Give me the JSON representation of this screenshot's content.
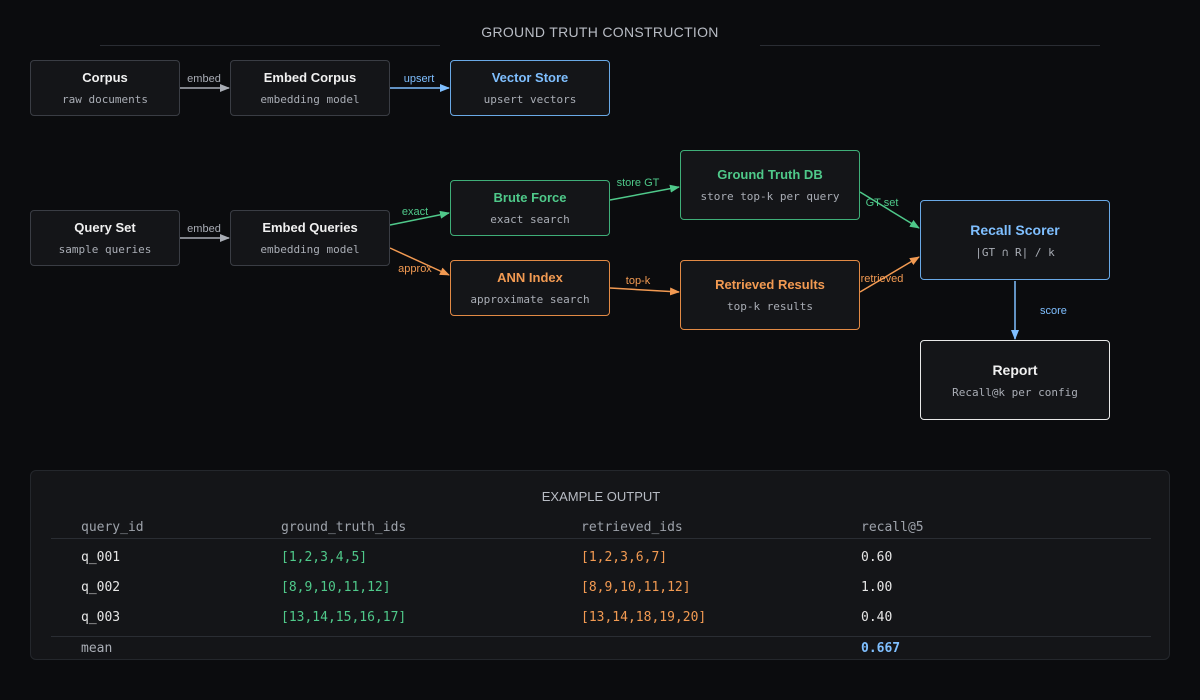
{
  "diagram": {
    "title": "GROUND TRUTH CONSTRUCTION",
    "nodes": {
      "corpus": {
        "title": "Corpus",
        "sub": "raw documents"
      },
      "embed_corpus": {
        "title": "Embed Corpus",
        "sub": "embedding model"
      },
      "vector_store": {
        "title": "Vector Store",
        "sub": "upsert vectors"
      },
      "query_set": {
        "title": "Query Set",
        "sub": "sample queries"
      },
      "embed_queries": {
        "title": "Embed Queries",
        "sub": "embedding model"
      },
      "brute_force": {
        "title": "Brute Force",
        "sub": "exact search"
      },
      "ann_index": {
        "title": "ANN Index",
        "sub": "approximate search"
      },
      "ground_truth_db": {
        "title": "Ground Truth DB",
        "sub": "store top-k per query"
      },
      "retrieved_results": {
        "title": "Retrieved Results",
        "sub": "top-k results"
      },
      "recall_scorer": {
        "title": "Recall Scorer",
        "sub": "|GT ∩ R| / k"
      },
      "report": {
        "title": "Report",
        "sub": "Recall@k per config"
      }
    },
    "edges": {
      "embed_1": "embed",
      "upsert": "upsert",
      "embed_2": "embed",
      "exact": "exact",
      "approx": "approx",
      "store_gt": "store GT",
      "top_k": "top-k",
      "gt_set": "GT set",
      "retrieved": "retrieved",
      "score": "score"
    },
    "colors": {
      "blue": "#7fbfff",
      "green": "#4fc98a",
      "orange": "#f29a52",
      "gray": "#a9adb5"
    }
  },
  "example": {
    "title": "EXAMPLE OUTPUT",
    "headers": [
      "query_id",
      "ground_truth_ids",
      "retrieved_ids",
      "recall@5"
    ],
    "rows": [
      [
        "q_001",
        "[1,2,3,4,5]",
        "[1,2,3,6,7]",
        "0.60"
      ],
      [
        "q_002",
        "[8,9,10,11,12]",
        "[8,9,10,11,12]",
        "1.00"
      ],
      [
        "q_003",
        "[13,14,15,16,17]",
        "[13,14,18,19,20]",
        "0.40"
      ]
    ],
    "mean_label": "mean",
    "mean_value": "0.667"
  }
}
